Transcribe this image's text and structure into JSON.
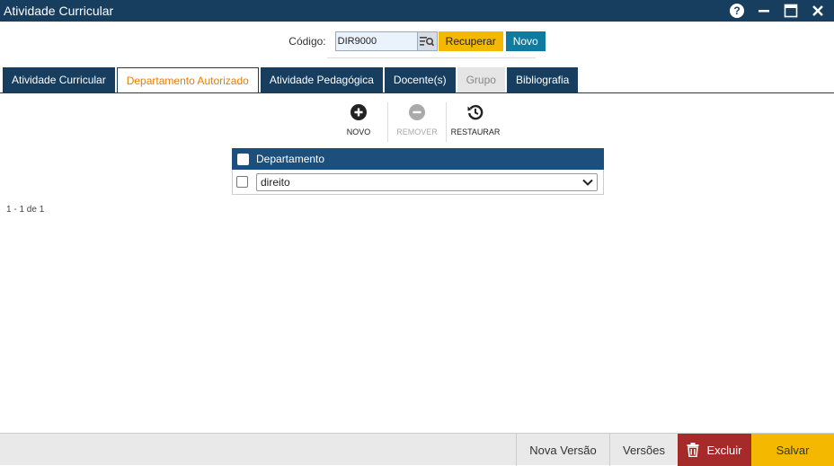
{
  "window": {
    "title": "Atividade Curricular"
  },
  "code": {
    "label": "Código:",
    "value": "DIR9000",
    "recover_label": "Recuperar",
    "new_label": "Novo"
  },
  "tabs": [
    {
      "label": "Atividade Curricular",
      "state": "normal"
    },
    {
      "label": "Departamento Autorizado",
      "state": "active"
    },
    {
      "label": "Atividade Pedagógica",
      "state": "normal"
    },
    {
      "label": "Docente(s)",
      "state": "normal"
    },
    {
      "label": "Grupo",
      "state": "disabled"
    },
    {
      "label": "Bibliografia",
      "state": "normal"
    }
  ],
  "toolbar": {
    "new_label": "NOVO",
    "remove_label": "REMOVER",
    "restore_label": "RESTAURAR"
  },
  "grid": {
    "header": "Departamento",
    "rows": [
      {
        "department": "direito"
      }
    ]
  },
  "pager": {
    "text": "1 - 1 de 1"
  },
  "footer": {
    "new_version": "Nova Versão",
    "versions": "Versões",
    "delete": "Excluir",
    "save": "Salvar"
  },
  "colors": {
    "primary": "#173d5f",
    "accent": "#f5b800",
    "active_tab_text": "#e67e00",
    "danger": "#a52a2a",
    "teal": "#0f7ba0"
  }
}
